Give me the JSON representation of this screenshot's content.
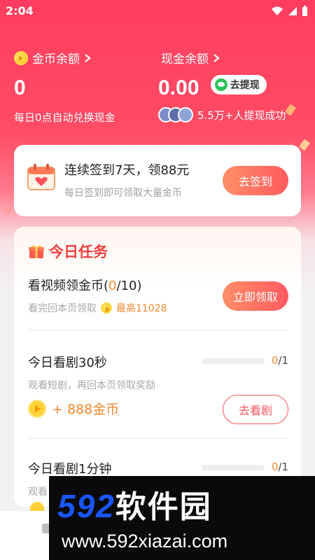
{
  "status_bar": {
    "time": "2:04"
  },
  "balance": {
    "coin_label": "金币余额",
    "coin_value": "0",
    "coin_sub": "每日0点自动兑换现金",
    "cash_label": "现金余额",
    "cash_value": "0.00",
    "withdraw_label": "去提现",
    "withdraw_stat": "5.5万+人提现成功"
  },
  "signin": {
    "title": "连续签到7天，领88元",
    "subtitle": "每日签到即可领取大量金币",
    "button": "去签到"
  },
  "tasks": {
    "section_title": "今日任务",
    "items": [
      {
        "name_prefix": "看视频领金币(",
        "progress_done": "0",
        "name_suffix": "/10)",
        "desc": "看完回本页领取",
        "reward_note": "最高11028",
        "button": "立即领取"
      },
      {
        "name": "今日看剧30秒",
        "progress_done": "0",
        "progress_total": "/1",
        "progress_fraction": 0,
        "desc": "观看短剧，再回本页领取奖励",
        "reward": "+ 888金币",
        "button": "去看剧"
      },
      {
        "name": "今日看剧1分钟",
        "progress_done": "0",
        "progress_total": "/1",
        "progress_fraction": 0,
        "desc": "观看"
      }
    ]
  },
  "watermark": {
    "brand_num": "592",
    "brand_cn": "软件园",
    "url": "www.592xiazai.com"
  },
  "colors": {
    "accent": "#ff3c5f",
    "orange": "#ef8a2d",
    "button_gradient_start": "#ff8e67",
    "button_gradient_end": "#ff5a5f"
  }
}
